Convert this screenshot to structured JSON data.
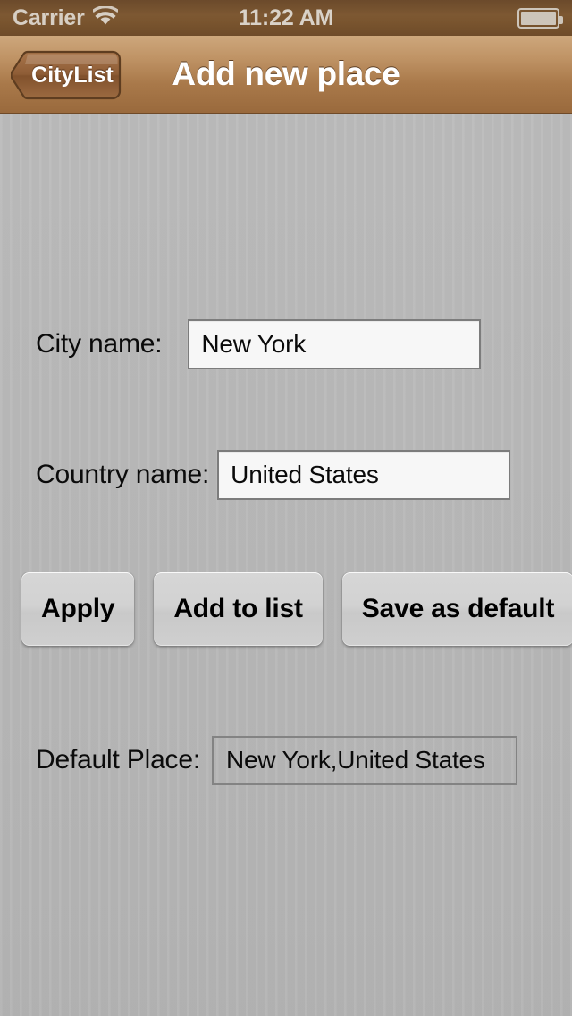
{
  "status_bar": {
    "carrier": "Carrier",
    "wifi_icon": "wifi-icon",
    "time": "11:22 AM",
    "battery_icon": "battery-full-icon"
  },
  "nav_bar": {
    "back_button_label": "CityList",
    "title": "Add new place"
  },
  "form": {
    "city": {
      "label": "City name:",
      "value": "New York",
      "placeholder": ""
    },
    "country": {
      "label": "Country name:",
      "value": "United States",
      "placeholder": ""
    },
    "default_place": {
      "label": "Default Place:",
      "value": "New York,United States"
    }
  },
  "buttons": {
    "apply": "Apply",
    "add_to_list": "Add to list",
    "save_as_default": "Save as default"
  },
  "colors": {
    "status_bar": "#7d5832",
    "nav_bar_top": "#cda77c",
    "nav_bar_bottom": "#9a6a3d",
    "content_background": "#b8b8b8",
    "field_background": "#f7f7f7",
    "field_border": "#7c7c7c",
    "button_face": "#d2d2d2",
    "title_text": "#ffffff",
    "label_text": "#0b0b0b"
  }
}
